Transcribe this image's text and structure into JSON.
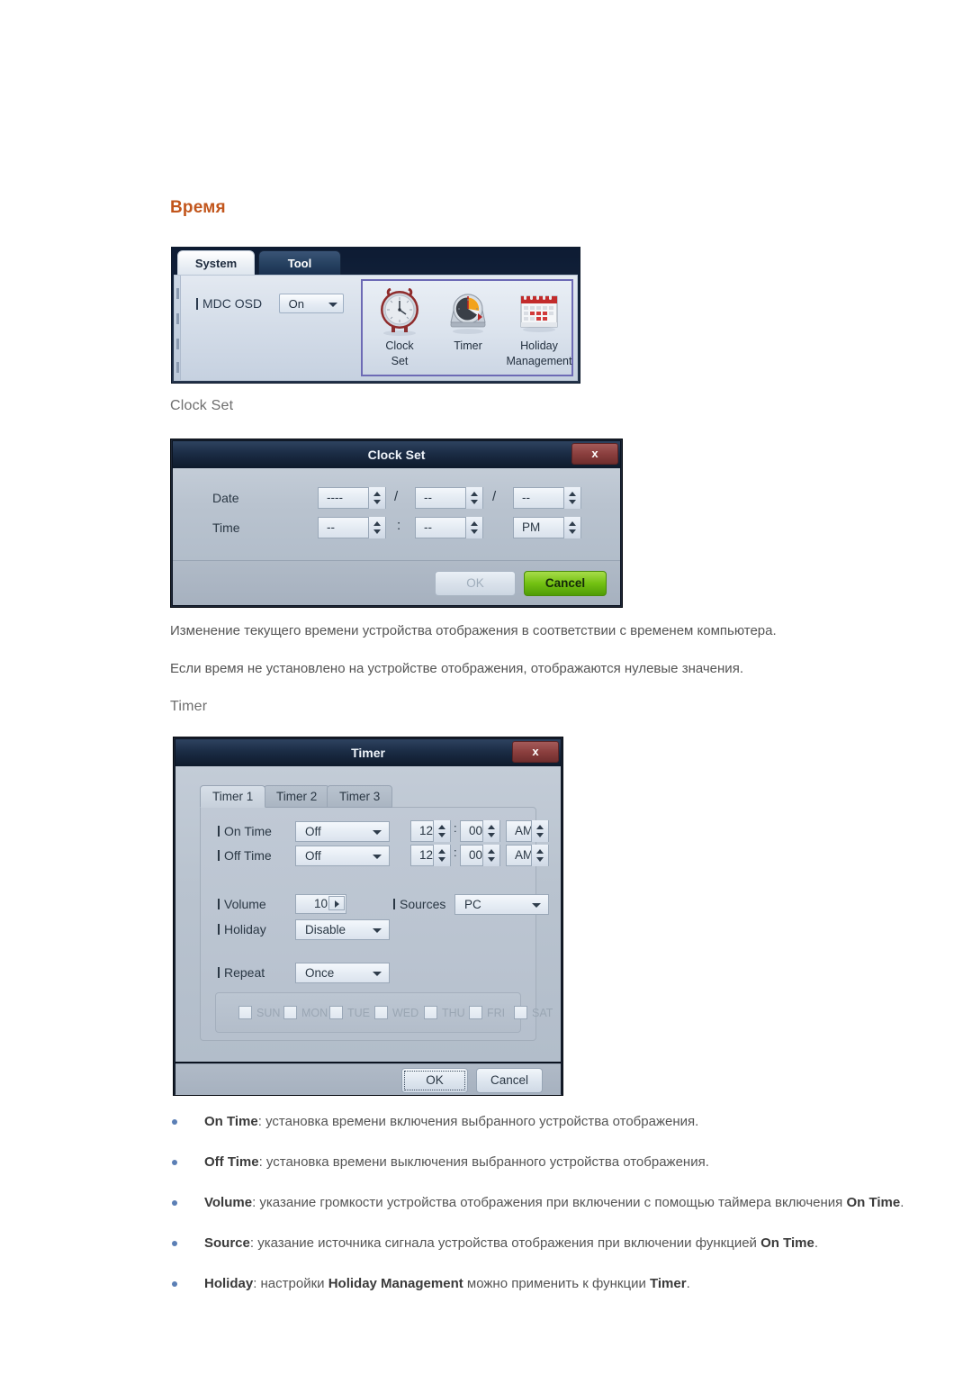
{
  "page": {
    "heading": "Время",
    "sub_headings": {
      "clock_set": "Clock Set",
      "timer": "Timer"
    },
    "paragraphs": [
      "Изменение текущего времени устройства отображения в соответствии с временем компьютера.",
      "Если время не установлено на устройстве отображения, отображаются нулевые значения."
    ]
  },
  "toolbar": {
    "tabs": [
      {
        "label": "System",
        "active": true
      },
      {
        "label": "Tool",
        "active": false
      }
    ],
    "mdc_osd": {
      "label": "MDC OSD",
      "value": "On"
    },
    "icons": [
      {
        "name": "clock-set-icon",
        "caption_line1": "Clock",
        "caption_line2": "Set"
      },
      {
        "name": "timer-icon",
        "caption_line1": "Timer",
        "caption_line2": ""
      },
      {
        "name": "holiday-management-icon",
        "caption_line1": "Holiday",
        "caption_line2": "Management"
      }
    ],
    "selection_color": "#6d6ab5"
  },
  "clock_set_dialog": {
    "title": "Clock Set",
    "close_label": "x",
    "rows": [
      {
        "label": "Date",
        "fields": [
          {
            "value": "----"
          },
          {
            "value": "--"
          },
          {
            "value": "--"
          }
        ],
        "separators": [
          "/",
          "/"
        ]
      },
      {
        "label": "Time",
        "fields": [
          {
            "value": "--"
          },
          {
            "value": "--"
          },
          {
            "value": "PM"
          }
        ],
        "separators": [
          ":"
        ]
      }
    ],
    "buttons": {
      "ok": "OK",
      "cancel": "Cancel"
    },
    "cancel_color": "#73c112"
  },
  "timer_dialog": {
    "title": "Timer",
    "close_label": "x",
    "tabs": [
      {
        "label": "Timer 1",
        "active": true
      },
      {
        "label": "Timer 2",
        "active": false
      },
      {
        "label": "Timer 3",
        "active": false
      }
    ],
    "on_time": {
      "label": "On Time",
      "mode": "Off",
      "hour": "12",
      "minute": "00",
      "meridiem": "AM"
    },
    "off_time": {
      "label": "Off Time",
      "mode": "Off",
      "hour": "12",
      "minute": "00",
      "meridiem": "AM"
    },
    "volume": {
      "label": "Volume",
      "value": "10"
    },
    "sources": {
      "label": "Sources",
      "value": "PC"
    },
    "holiday": {
      "label": "Holiday",
      "value": "Disable"
    },
    "repeat": {
      "label": "Repeat",
      "value": "Once"
    },
    "days": [
      {
        "code": "SUN",
        "checked": false
      },
      {
        "code": "MON",
        "checked": false
      },
      {
        "code": "TUE",
        "checked": false
      },
      {
        "code": "WED",
        "checked": false
      },
      {
        "code": "THU",
        "checked": false
      },
      {
        "code": "FRI",
        "checked": false
      },
      {
        "code": "SAT",
        "checked": false
      }
    ],
    "buttons": {
      "ok": "OK",
      "cancel": "Cancel"
    },
    "time_separator": ":"
  },
  "bullets": [
    {
      "term": "On Time",
      "rest": ": установка времени включения выбранного устройства отображения."
    },
    {
      "term": "Off Time",
      "rest": ": установка времени выключения выбранного устройства отображения."
    },
    {
      "term": "Volume",
      "rest": ": указание громкости устройства отображения при включении с помощью таймера включения ",
      "term2": "On Time",
      "tail": "."
    },
    {
      "term": "Source",
      "rest": ": указание источника сигнала устройства отображения при включении функцией ",
      "term2": "On Time",
      "tail": "."
    },
    {
      "term": "Holiday",
      "rest": ": настройки ",
      "term2": "Holiday Management",
      "mid": " можно применить к функции ",
      "term3": "Timer",
      "tail": "."
    }
  ]
}
